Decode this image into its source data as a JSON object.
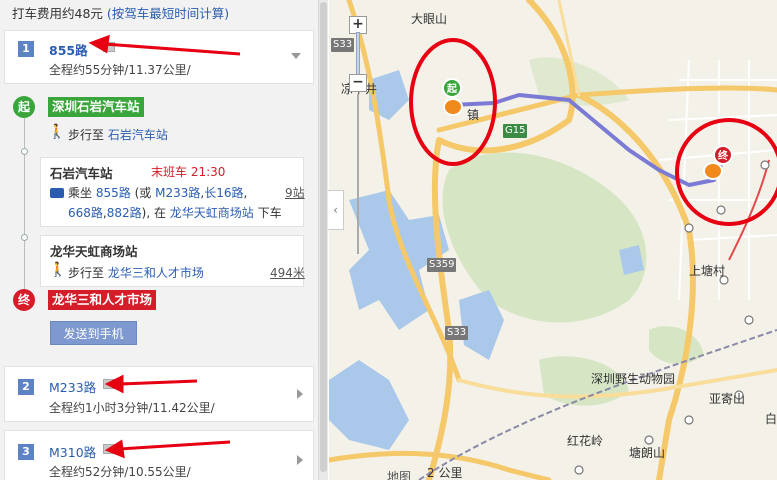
{
  "summary": {
    "fare_text": "打车费用约48元",
    "fare_note": "(按驾车最短时间计算)"
  },
  "routes": [
    {
      "index": "1",
      "name": "855路",
      "detail": "全程约55分钟/11.37公里/"
    },
    {
      "index": "2",
      "name": "M233路",
      "detail": "全程约1小时3分钟/11.42公里/"
    },
    {
      "index": "3",
      "name": "M310路",
      "detail": "全程约52分钟/10.55公里/"
    }
  ],
  "itinerary": {
    "start_marker": "起",
    "start_stop": "深圳石岩汽车站",
    "walk1_prefix": "步行至",
    "walk1_target": "石岩汽车站",
    "board_stop": "石岩汽车站",
    "last_bus": "末班车 21:30",
    "ride_prefix": "乘坐",
    "ride_line": "855路",
    "ride_alt_prefix": "(或",
    "ride_alt1": "M233路",
    "ride_comma1": ",",
    "ride_alt2": "长16路",
    "ride_comma2": ",",
    "ride_alt3": "668路",
    "ride_comma3": ",",
    "ride_alt4": "882路",
    "ride_mid": "), 在",
    "ride_alight": "龙华天虹商场站",
    "ride_suffix": "下车",
    "stops_count": "9站",
    "alight_stop": "龙华天虹商场站",
    "walk2_prefix": "步行至",
    "walk2_target": "龙华三和人才市场",
    "walk2_distance": "494米",
    "end_marker": "终",
    "end_stop": "龙华三和人才市场",
    "send_button": "发送到手机"
  },
  "map": {
    "zoom_in": "+",
    "zoom_out": "−",
    "collapse": "‹",
    "labels": {
      "daxianshan": "大眼山",
      "liangxiajing": "凉下井",
      "town": "镇",
      "shangtangcun": "上塘村",
      "zoo": "深圳野生动物园",
      "yajishan": "亚寄山",
      "honghualing": "红花岭",
      "tanglangshan": "塘朗山",
      "bai": "白",
      "scale": "2 公里",
      "logo": "地图"
    },
    "roads": {
      "s33_top": "S33",
      "s33_mid": "S33",
      "s359": "S359",
      "g15": "G15"
    },
    "start_icon": "起",
    "end_icon": "终",
    "route_color": "#7b7bd6",
    "annotation_color": "#e60012"
  }
}
